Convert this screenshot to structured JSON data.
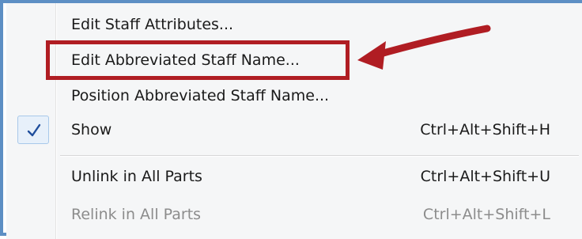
{
  "menu": {
    "items": [
      {
        "label": "Edit Staff Attributes...",
        "shortcut": "",
        "enabled": true,
        "checked": false
      },
      {
        "label": "Edit Abbreviated Staff Name...",
        "shortcut": "",
        "enabled": true,
        "checked": false
      },
      {
        "label": "Position Abbreviated Staff Name...",
        "shortcut": "",
        "enabled": true,
        "checked": false
      },
      {
        "label": "Show",
        "shortcut": "Ctrl+Alt+Shift+H",
        "enabled": true,
        "checked": true
      },
      {
        "label": "Unlink in All Parts",
        "shortcut": "Ctrl+Alt+Shift+U",
        "enabled": true,
        "checked": false
      },
      {
        "label": "Relink in All Parts",
        "shortcut": "Ctrl+Alt+Shift+L",
        "enabled": false,
        "checked": false
      }
    ]
  },
  "annotation": {
    "highlight_color": "#b01d23",
    "arrow_color": "#b01d23",
    "highlighted_item": "Edit Abbreviated Staff Name..."
  },
  "icons": {
    "check": "checkmark-icon"
  }
}
